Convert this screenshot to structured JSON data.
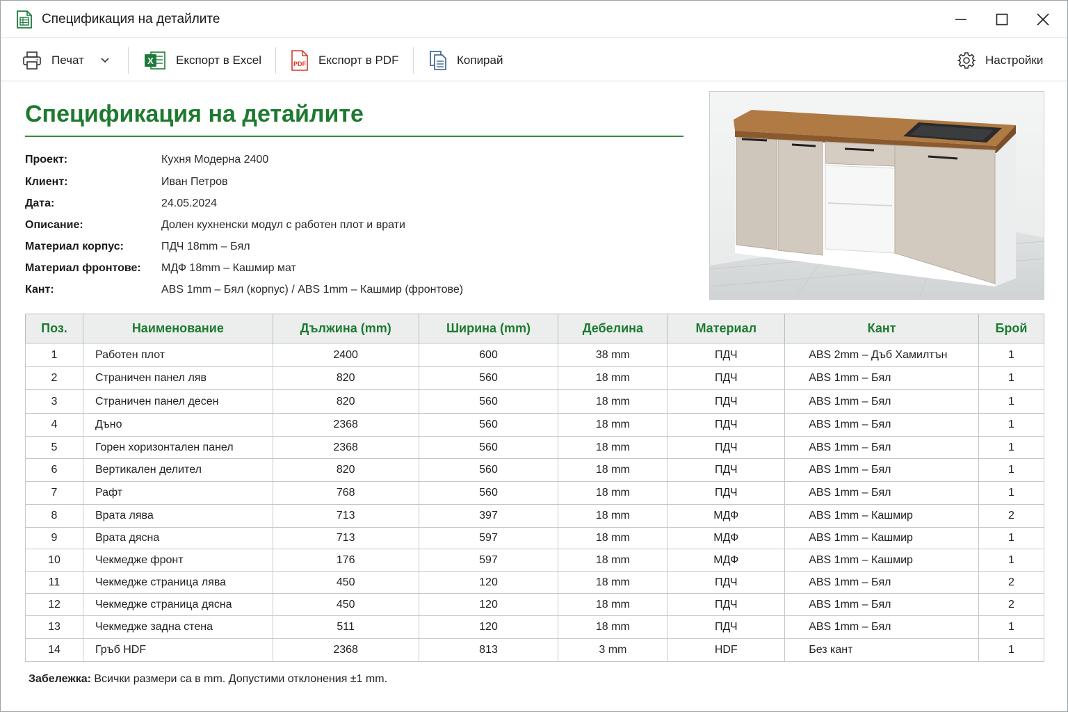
{
  "window": {
    "title": "Спецификация на детайлите"
  },
  "toolbar": {
    "print_label": "Печат",
    "excel_label": "Експорт в Excel",
    "pdf_label": "Експорт в PDF",
    "pdf_icon_text": "PDF",
    "excel_icon_text": "X",
    "copy_label": "Копирай",
    "settings_label": "Настройки"
  },
  "document": {
    "heading": "Спецификация на детайлите",
    "meta": [
      {
        "key": "Проект:",
        "value": "Кухня Модерна 2400"
      },
      {
        "key": "Клиент:",
        "value": "Иван Петров"
      },
      {
        "key": "Дата:",
        "value": "24.05.2024"
      },
      {
        "key": "Описание:",
        "value": "Долен кухненски модул с работен плот и врати"
      },
      {
        "key": "Материал корпус:",
        "value": "ПДЧ 18mm – Бял"
      },
      {
        "key": "Материал фронтове:",
        "value": "МДФ 18mm – Кашмир мат"
      },
      {
        "key": "Кант:",
        "value": "ABS 1mm – Бял (корпус) / ABS 1mm – Кашмир (фронтове)"
      }
    ]
  },
  "table": {
    "headers": [
      "Поз.",
      "Наименование",
      "Дължина (mm)",
      "Ширина (mm)",
      "Дебелина",
      "Материал",
      "Кант",
      "Брой"
    ],
    "rows": [
      [
        "1",
        "Работен плот",
        "2400",
        "600",
        "38 mm",
        "ПДЧ",
        "ABS 2mm – Дъб Хамилтън",
        "1"
      ],
      [
        "2",
        "Страничен панел ляв",
        "820",
        "560",
        "18 mm",
        "ПДЧ",
        "ABS 1mm – Бял",
        "1"
      ],
      [
        "3",
        "Страничен панел десен",
        "820",
        "560",
        "18 mm",
        "ПДЧ",
        "ABS 1mm – Бял",
        "1"
      ],
      [
        "4",
        "Дъно",
        "2368",
        "560",
        "18 mm",
        "ПДЧ",
        "ABS 1mm – Бял",
        "1"
      ],
      [
        "5",
        "Горен хоризонтален панел",
        "2368",
        "560",
        "18 mm",
        "ПДЧ",
        "ABS 1mm – Бял",
        "1"
      ],
      [
        "6",
        "Вертикален делител",
        "820",
        "560",
        "18 mm",
        "ПДЧ",
        "ABS 1mm – Бял",
        "1"
      ],
      [
        "7",
        "Рафт",
        "768",
        "560",
        "18 mm",
        "ПДЧ",
        "ABS 1mm – Бял",
        "1"
      ],
      [
        "8",
        "Врата лява",
        "713",
        "397",
        "18 mm",
        "МДФ",
        "ABS 1mm – Кашмир",
        "2"
      ],
      [
        "9",
        "Врата дясна",
        "713",
        "597",
        "18 mm",
        "МДФ",
        "ABS 1mm – Кашмир",
        "1"
      ],
      [
        "10",
        "Чекмедже фронт",
        "176",
        "597",
        "18 mm",
        "МДФ",
        "ABS 1mm – Кашмир",
        "1"
      ],
      [
        "11",
        "Чекмедже страница лява",
        "450",
        "120",
        "18 mm",
        "ПДЧ",
        "ABS 1mm – Бял",
        "2"
      ],
      [
        "12",
        "Чекмедже страница дясна",
        "450",
        "120",
        "18 mm",
        "ПДЧ",
        "ABS 1mm – Бял",
        "2"
      ],
      [
        "13",
        "Чекмедже задна стена",
        "511",
        "120",
        "18 mm",
        "ПДЧ",
        "ABS 1mm – Бял",
        "1"
      ],
      [
        "14",
        "Гръб HDF",
        "2368",
        "813",
        "3 mm",
        "HDF",
        "Без кант",
        "1"
      ]
    ]
  },
  "note": {
    "label": "Забележка:",
    "text": "Всички размери са в mm. Допустими отклонения ±1 mm."
  },
  "colors": {
    "accent": "#1d7a2f",
    "excel": "#1e7a3c",
    "pdf": "#d23a2a",
    "copy": "#2f5d8c"
  }
}
